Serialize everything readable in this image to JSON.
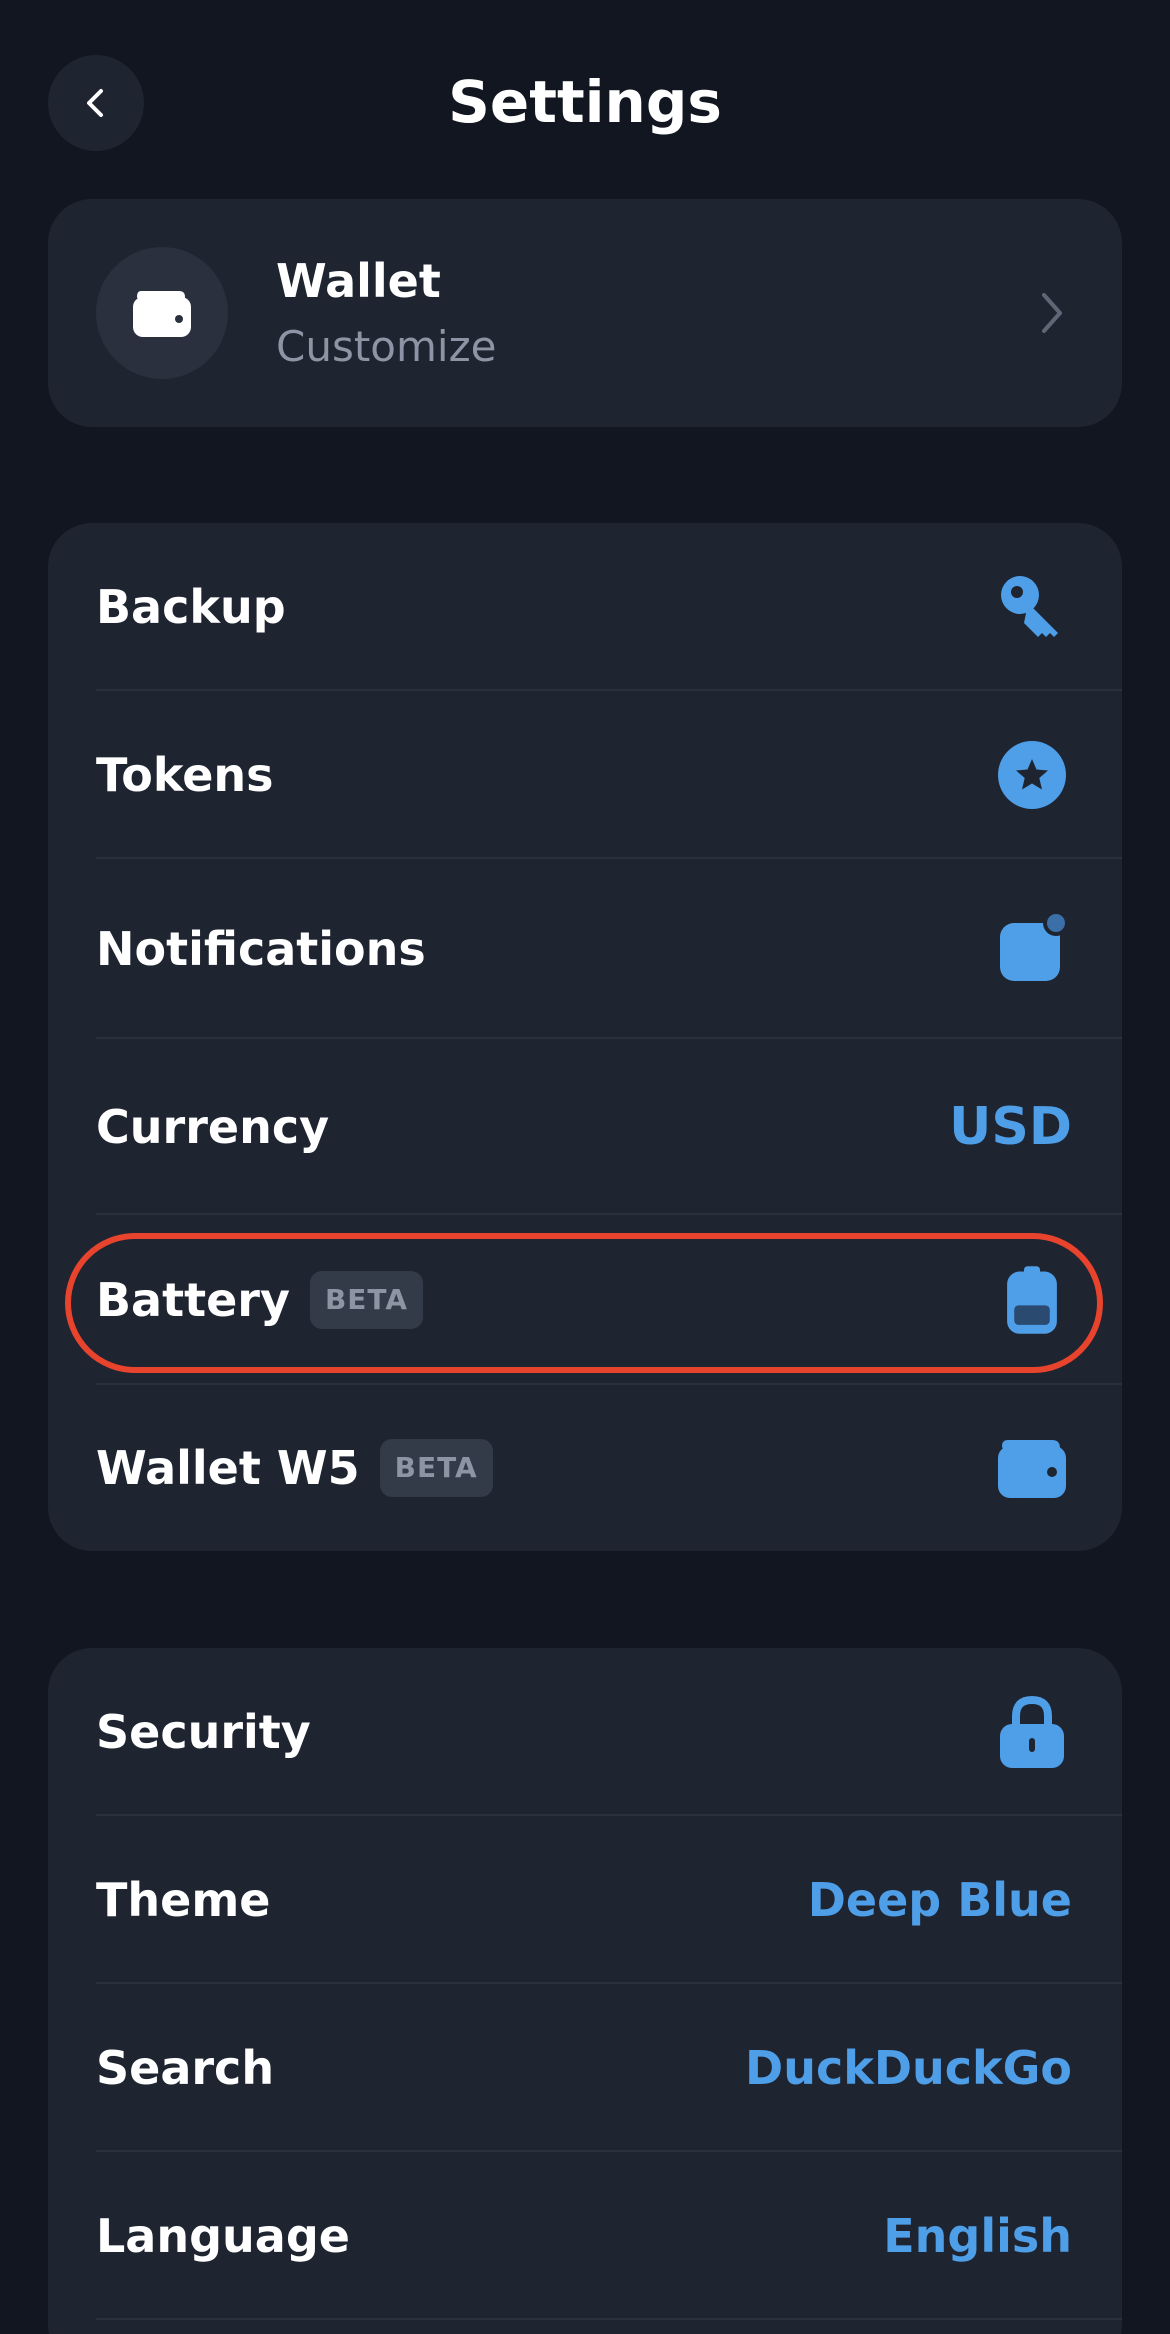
{
  "header": {
    "title": "Settings",
    "back_icon": "chevron-left-icon"
  },
  "wallet_card": {
    "name": "Wallet",
    "subtitle": "Customize",
    "icon": "wallet-icon"
  },
  "group_main": {
    "items": [
      {
        "label": "Backup",
        "icon": "key-icon"
      },
      {
        "label": "Tokens",
        "icon": "star-circle-icon"
      },
      {
        "label": "Notifications",
        "icon": "notification-icon"
      },
      {
        "label": "Currency",
        "value": "USD"
      },
      {
        "label": "Battery",
        "badge": "BETA",
        "icon": "battery-icon"
      },
      {
        "label": "Wallet W5",
        "badge": "BETA",
        "icon": "wallet-icon"
      }
    ]
  },
  "group_prefs": {
    "items": [
      {
        "label": "Security",
        "icon": "lock-icon"
      },
      {
        "label": "Theme",
        "value": "Deep Blue"
      },
      {
        "label": "Search",
        "value": "DuckDuckGo"
      },
      {
        "label": "Language",
        "value": "English"
      }
    ]
  },
  "colors": {
    "background": "#121620",
    "card": "#1e2430",
    "accent": "#4f9ee8",
    "highlight": "#e8432d"
  }
}
